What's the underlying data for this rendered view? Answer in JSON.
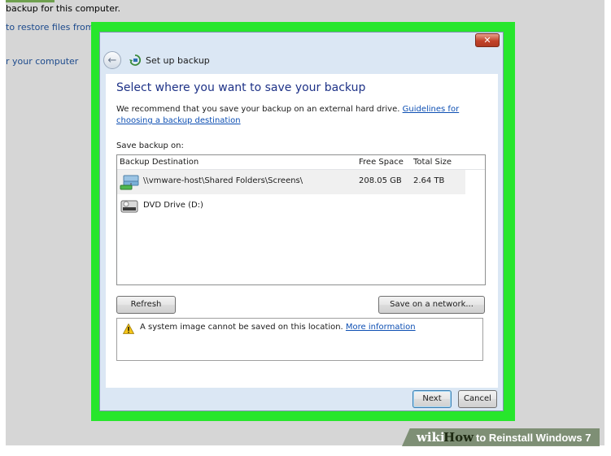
{
  "background": {
    "line1": "backup for this computer.",
    "link1": "to restore files from",
    "link2": "r your computer"
  },
  "dialog": {
    "close_label": "✕",
    "back_glyph": "←",
    "title": "Set up backup",
    "heading": "Select where you want to save your backup",
    "recommendation": "We recommend that you save your backup on an external hard drive.",
    "guidelines_link": "Guidelines for choosing a backup destination",
    "save_on_label": "Save backup on:",
    "columns": [
      "Backup Destination",
      "Free Space",
      "Total Size"
    ],
    "destinations": [
      {
        "name": "\\\\vmware-host\\Shared Folders\\Screens\\",
        "free": "208.05 GB",
        "total": "2.64 TB",
        "icon": "network-drive-icon"
      },
      {
        "name": "DVD Drive (D:)",
        "free": "",
        "total": "",
        "icon": "dvd-drive-icon"
      }
    ],
    "refresh_label": "Refresh",
    "network_label": "Save on a network...",
    "warning_text": "A system image cannot be saved on this location.",
    "more_info_link": "More information",
    "next_label": "Next",
    "cancel_label": "Cancel"
  },
  "watermark": {
    "wiki": "wiki",
    "how": "How",
    "rest": "to Reinstall Windows 7"
  },
  "colors": {
    "highlight": "#27e62c",
    "heading": "#1e3287",
    "link": "#0d4fb3",
    "selected_row": "#f0f0f0"
  }
}
